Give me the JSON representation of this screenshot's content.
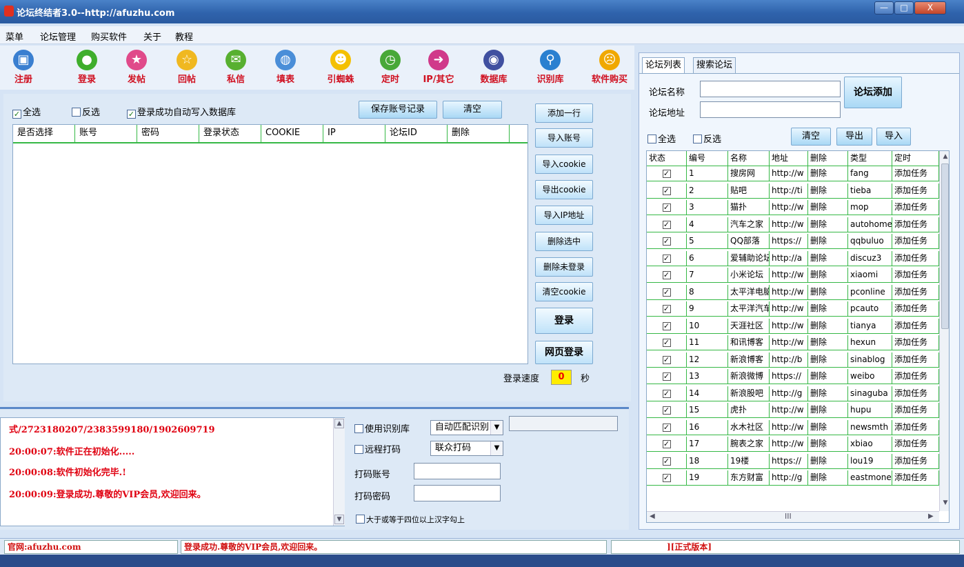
{
  "window": {
    "title": "论坛终结者3.0--http://afuzhu.com",
    "min_label": "—",
    "max_label": "□",
    "close_label": "X"
  },
  "menu": [
    "菜单",
    "论坛管理",
    "购买软件",
    "关于",
    "教程"
  ],
  "toolbar": [
    {
      "label": "注册",
      "icon": "register-window-icon",
      "color": "#3a7fd0"
    },
    {
      "label": "登录",
      "icon": "user-login-icon",
      "color": "#3fae2c"
    },
    {
      "label": "发帖",
      "icon": "post-star-icon",
      "color": "#e04a8a"
    },
    {
      "label": "回帖",
      "icon": "reply-star-icon",
      "color": "#f0b820"
    },
    {
      "label": "私信",
      "icon": "chat-bubble-icon",
      "color": "#58b030"
    },
    {
      "label": "填表",
      "icon": "fill-form-globe-icon",
      "color": "#4a8ed8"
    },
    {
      "label": "引蜘蛛",
      "icon": "smiley-spider-icon",
      "color": "#f4c000"
    },
    {
      "label": "定时",
      "icon": "timer-clock-icon",
      "color": "#48a838"
    },
    {
      "label": "IP/其它",
      "icon": "ip-arrow-icon",
      "color": "#d03a8a"
    },
    {
      "label": "数据库",
      "icon": "database-icon",
      "color": "#4050a0"
    },
    {
      "label": "识别库",
      "icon": "search-magnifier-icon",
      "color": "#2a80d0"
    },
    {
      "label": "软件购买",
      "icon": "buy-software-face-icon",
      "color": "#f0a800"
    }
  ],
  "account": {
    "select_all": "全选",
    "invert": "反选",
    "auto_write": "登录成功自动写入数据库",
    "save_btn": "保存账号记录",
    "clear_btn": "清空",
    "columns": [
      "是否选择",
      "账号",
      "密码",
      "登录状态",
      "COOKIE",
      "IP",
      "论坛ID",
      "删除"
    ],
    "side_buttons": [
      "添加一行",
      "导入账号",
      "导入cookie",
      "导出cookie",
      "导入IP地址",
      "删除选中",
      "删除未登录",
      "清空cookie"
    ],
    "login_btn": "登录",
    "web_login_btn": "网页登录",
    "speed_label": "登录速度",
    "speed_value": "0",
    "speed_unit": "秒"
  },
  "log": {
    "lines": [
      "式/2723180207/2383599180/1902609719",
      "20:00:07:软件正在初始化.....",
      "20:00:08:软件初始化完毕.!",
      "20:00:09:登录成功.尊敬的VIP会员,欢迎回来。"
    ]
  },
  "captcha": {
    "use_lib": "使用识别库",
    "lib_select": "自动匹配识别",
    "remote": "远程打码",
    "remote_select": "联众打码",
    "account_label": "打码账号",
    "password_label": "打码密码",
    "option4": "大于或等于四位以上汉字勾上"
  },
  "status": {
    "site": "官网:afuzhu.com",
    "message": "登录成功.尊敬的VIP会员,欢迎回来。",
    "version": "][正式版本]"
  },
  "forum": {
    "tabs": [
      "论坛列表",
      "搜索论坛"
    ],
    "name_label": "论坛名称",
    "addr_label": "论坛地址",
    "add_btn": "论坛添加",
    "select_all": "全选",
    "invert": "反选",
    "clear_btn": "清空",
    "export_btn": "导出",
    "import_btn": "导入",
    "columns": [
      "状态",
      "编号",
      "名称",
      "地址",
      "删除",
      "类型",
      "定时"
    ],
    "scroll_mark": "III",
    "rows": [
      {
        "no": "1",
        "name": "搜房网",
        "addr": "http://w",
        "del": "删除",
        "type": "fang",
        "timer": "添加任务"
      },
      {
        "no": "2",
        "name": "贴吧",
        "addr": "http://ti",
        "del": "删除",
        "type": "tieba",
        "timer": "添加任务"
      },
      {
        "no": "3",
        "name": "猫扑",
        "addr": "http://w",
        "del": "删除",
        "type": "mop",
        "timer": "添加任务"
      },
      {
        "no": "4",
        "name": "汽车之家",
        "addr": "http://w",
        "del": "删除",
        "type": "autohome",
        "timer": "添加任务"
      },
      {
        "no": "5",
        "name": "QQ部落",
        "addr": "https://",
        "del": "删除",
        "type": "qqbuluo",
        "timer": "添加任务"
      },
      {
        "no": "6",
        "name": "爱辅助论坛",
        "addr": "http://a",
        "del": "删除",
        "type": "discuz3",
        "timer": "添加任务"
      },
      {
        "no": "7",
        "name": "小米论坛",
        "addr": "http://w",
        "del": "删除",
        "type": "xiaomi",
        "timer": "添加任务"
      },
      {
        "no": "8",
        "name": "太平洋电脑",
        "addr": "http://w",
        "del": "删除",
        "type": "pconline",
        "timer": "添加任务"
      },
      {
        "no": "9",
        "name": "太平洋汽车",
        "addr": "http://w",
        "del": "删除",
        "type": "pcauto",
        "timer": "添加任务"
      },
      {
        "no": "10",
        "name": "天涯社区",
        "addr": "http://w",
        "del": "删除",
        "type": "tianya",
        "timer": "添加任务"
      },
      {
        "no": "11",
        "name": "和讯博客",
        "addr": "http://w",
        "del": "删除",
        "type": "hexun",
        "timer": "添加任务"
      },
      {
        "no": "12",
        "name": "新浪博客",
        "addr": "http://b",
        "del": "删除",
        "type": "sinablog",
        "timer": "添加任务"
      },
      {
        "no": "13",
        "name": "新浪微博",
        "addr": "https://",
        "del": "删除",
        "type": "weibo",
        "timer": "添加任务"
      },
      {
        "no": "14",
        "name": "新浪股吧",
        "addr": "http://g",
        "del": "删除",
        "type": "sinaguba",
        "timer": "添加任务"
      },
      {
        "no": "15",
        "name": "虎扑",
        "addr": "http://w",
        "del": "删除",
        "type": "hupu",
        "timer": "添加任务"
      },
      {
        "no": "16",
        "name": "水木社区",
        "addr": "http://w",
        "del": "删除",
        "type": "newsmth",
        "timer": "添加任务"
      },
      {
        "no": "17",
        "name": "腕表之家",
        "addr": "http://w",
        "del": "删除",
        "type": "xbiao",
        "timer": "添加任务"
      },
      {
        "no": "18",
        "name": "19楼",
        "addr": "https://",
        "del": "删除",
        "type": "lou19",
        "timer": "添加任务"
      },
      {
        "no": "19",
        "name": "东方财富",
        "addr": "http://g",
        "del": "删除",
        "type": "eastmoney",
        "timer": "添加任务"
      }
    ]
  },
  "colors": {
    "accent_red": "#d01020",
    "grid_green": "#35b845",
    "speed_yellow": "#ffec00"
  }
}
